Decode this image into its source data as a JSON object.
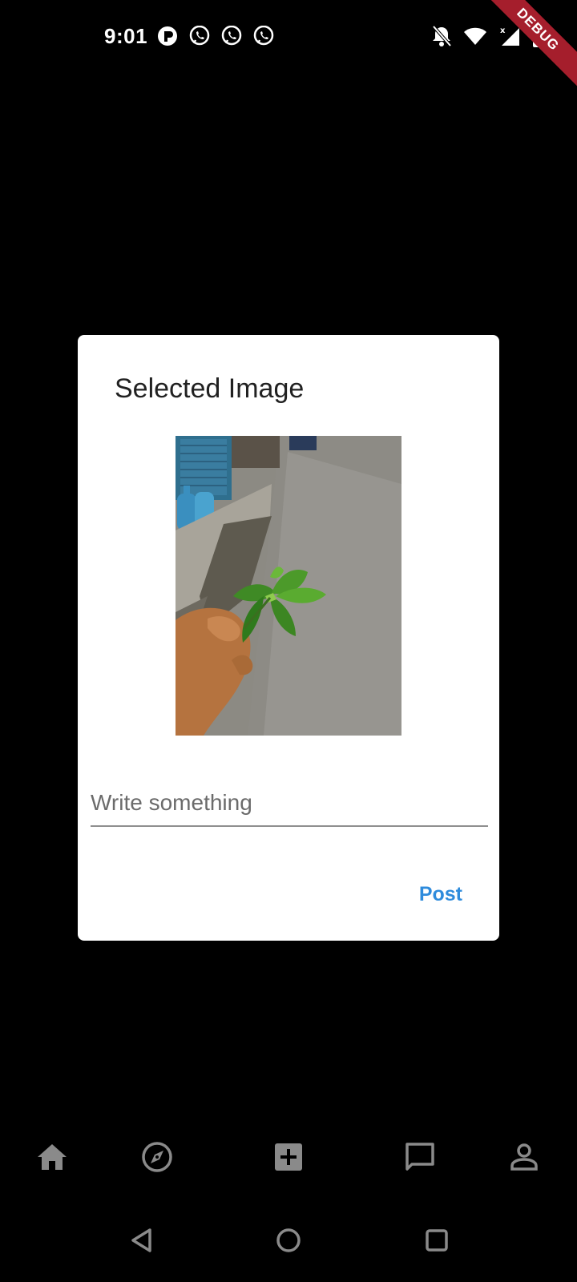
{
  "status_bar": {
    "time": "9:01",
    "notification_icons": [
      "app-r-icon",
      "viber-icon",
      "viber-icon",
      "viber-icon"
    ],
    "system_icons": [
      "notifications-off-icon",
      "wifi-icon",
      "signal-icon",
      "battery-charging-icon"
    ],
    "debug_label": "DEBUG"
  },
  "dialog": {
    "title": "Selected Image",
    "image_icon": "selected-photo",
    "input_placeholder": "Write something",
    "input_value": "",
    "post_label": "Post"
  },
  "bottom_nav": {
    "items": [
      {
        "icon": "home-icon"
      },
      {
        "icon": "compass-icon"
      },
      {
        "icon": "add-box-icon"
      },
      {
        "icon": "chat-icon"
      },
      {
        "icon": "person-icon"
      }
    ]
  },
  "system_nav": {
    "items": [
      {
        "icon": "back-icon"
      },
      {
        "icon": "home-circle-icon"
      },
      {
        "icon": "recents-icon"
      }
    ]
  },
  "colors": {
    "background": "#000000",
    "dialog_bg": "#ffffff",
    "accent": "#2e8bdc",
    "nav_icon": "#8a8a8a",
    "debug_banner": "#a51e2c"
  }
}
